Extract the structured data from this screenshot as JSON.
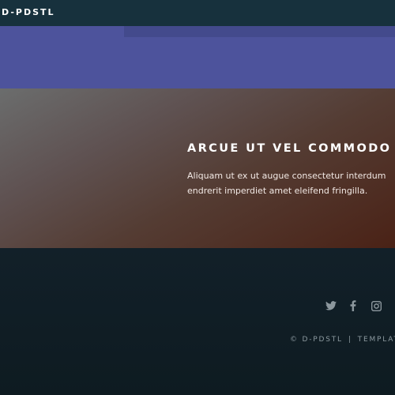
{
  "header": {
    "brand": "D-PDSTL"
  },
  "hero": {
    "title": "ARCUE UT VEL COMMODO",
    "text_line_1": "Aliquam ut ex ut augue consectetur interdum",
    "text_line_2": "endrerit imperdiet amet eleifend fringilla."
  },
  "footer": {
    "social_icons": [
      "twitter-icon",
      "facebook-icon",
      "instagram-icon"
    ],
    "copyright": "© D-PDSTL",
    "separator": "|",
    "credit": "TEMPLATE"
  },
  "colors": {
    "header_bg": "#17313d",
    "band_purple": "#4d539c",
    "hero_accent": "#4a2216",
    "footer_bg": "#0f1d24"
  }
}
